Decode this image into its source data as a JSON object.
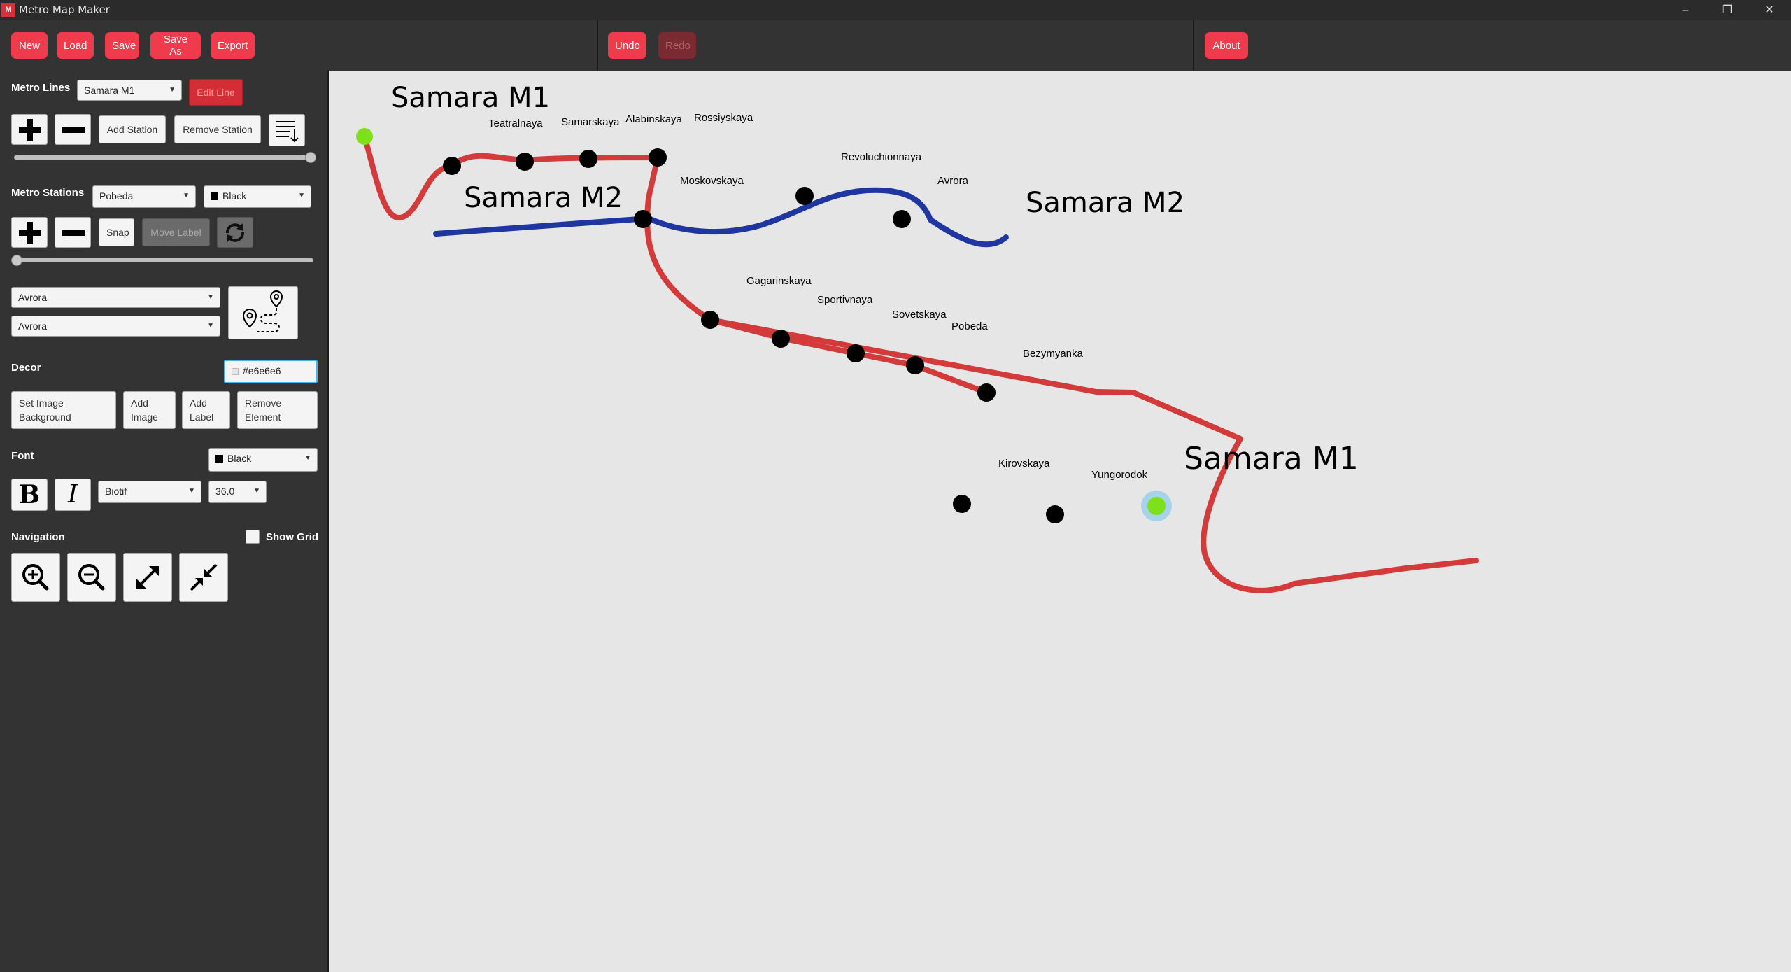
{
  "window": {
    "title": "Metro Map Maker",
    "icon_text": "M"
  },
  "toolbar": {
    "new": "New",
    "load": "Load",
    "save": "Save",
    "save_as": "Save As",
    "export": "Export",
    "undo": "Undo",
    "redo": "Redo",
    "about": "About"
  },
  "sidebar": {
    "metro_lines_label": "Metro Lines",
    "line_select": "Samara M1",
    "edit_line": "Edit Line",
    "add_station": "Add Station",
    "remove_station": "Remove Station",
    "metro_stations_label": "Metro Stations",
    "station_select": "Pobeda",
    "station_color": "Black",
    "snap": "Snap",
    "move_label": "Move Label",
    "route_from": "Avrora",
    "route_to": "Avrora",
    "decor_label": "Decor",
    "decor_color": "#e6e6e6",
    "set_image_bg_1": "Set Image",
    "set_image_bg_2": "Background",
    "add_image_1": "Add",
    "add_image_2": "Image",
    "add_label_1": "Add",
    "add_label_2": "Label",
    "remove_element_1": "Remove",
    "remove_element_2": "Element",
    "font_label": "Font",
    "font_color": "Black",
    "font_family": "Biotif",
    "font_size": "36.0",
    "navigation_label": "Navigation",
    "show_grid": "Show Grid"
  },
  "colors": {
    "accent": "#ef3b4c",
    "line_m1": "#d43a3a",
    "line_m2": "#1f36a0",
    "endpoint": "#7ee01b",
    "background": "#e6e6e6"
  },
  "map": {
    "line_labels": {
      "m1_start": "Samara M1",
      "m2_start": "Samara M2",
      "m2_end": "Samara M2",
      "m1_end": "Samara M1"
    },
    "stations": {
      "teatralnaya": "Teatralnaya",
      "samarskaya": "Samarskaya",
      "alabinskaya": "Alabinskaya",
      "rossiyskaya": "Rossiyskaya",
      "moskovskaya": "Moskovskaya",
      "revoluchionnaya": "Revoluchionnaya",
      "avrora": "Avrora",
      "gagarinskaya": "Gagarinskaya",
      "sportivnaya": "Sportivnaya",
      "sovetskaya": "Sovetskaya",
      "pobeda": "Pobeda",
      "bezymyanka": "Bezymyanka",
      "kirovskaya": "Kirovskaya",
      "yungorodok": "Yungorodok"
    }
  }
}
